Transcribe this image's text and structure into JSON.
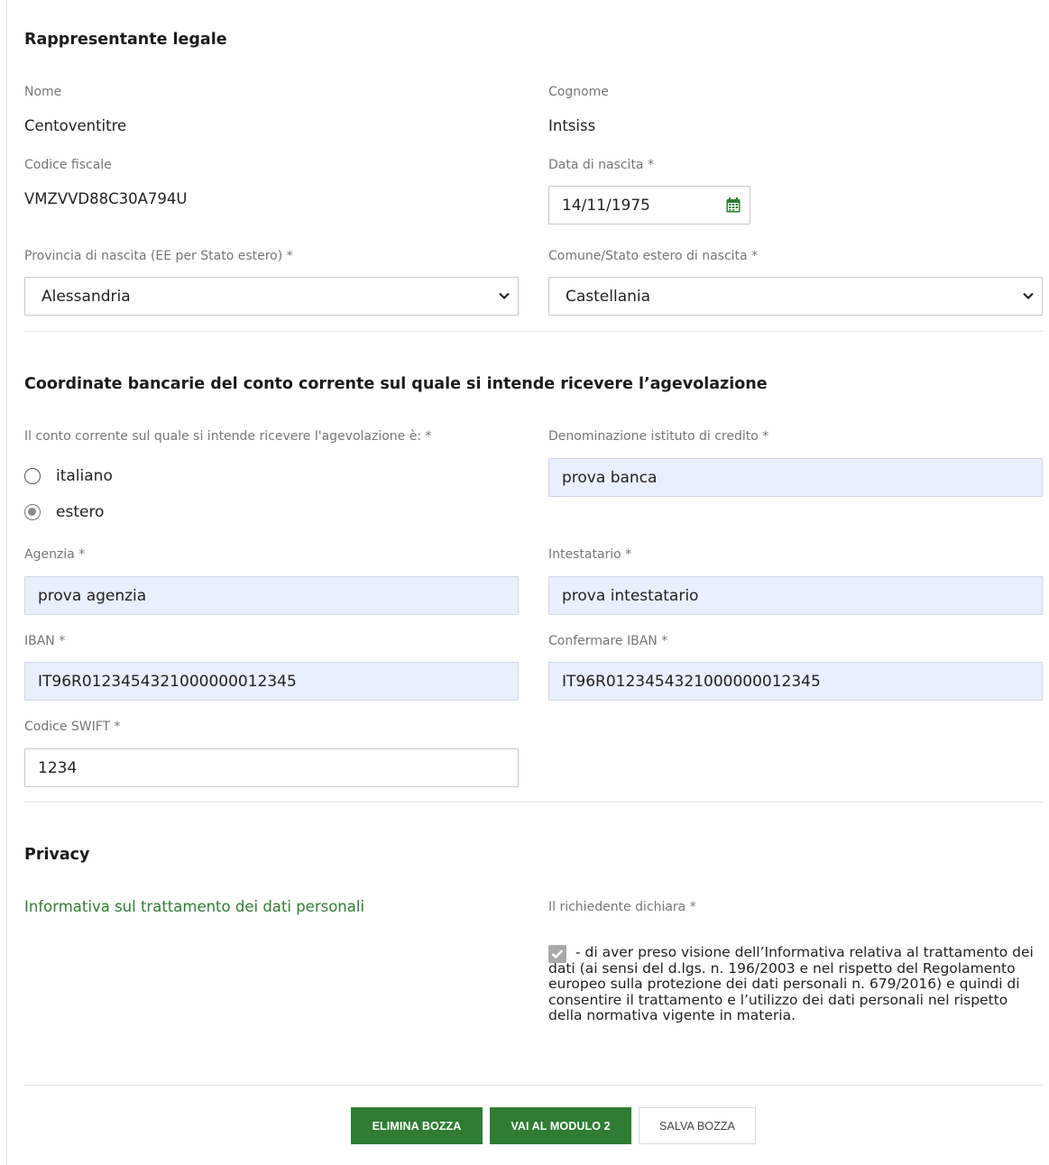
{
  "rappresentante": {
    "title": "Rappresentante legale",
    "nome_label": "Nome",
    "nome_value": "Centoventitre",
    "cognome_label": "Cognome",
    "cognome_value": "Intsiss",
    "cf_label": "Codice fiscale",
    "cf_value": "VMZVVD88C30A794U",
    "nascita_label": "Data di nascita *",
    "nascita_value": "14/11/1975",
    "provincia_label": "Provincia di nascita (EE per Stato estero) *",
    "provincia_value": "Alessandria",
    "comune_label": "Comune/Stato estero di nascita *",
    "comune_value": "Castellania"
  },
  "banca": {
    "title": "Coordinate bancarie del conto corrente sul quale si intende ricevere l’agevolazione",
    "conto_label": "Il conto corrente sul quale si intende ricevere l'agevolazione è: *",
    "option_italiano": "italiano",
    "option_estero": "estero",
    "selected_option": "estero",
    "istituto_label": "Denominazione istituto di credito *",
    "istituto_value": "prova banca",
    "agenzia_label": "Agenzia *",
    "agenzia_value": "prova agenzia",
    "intestatario_label": "Intestatario *",
    "intestatario_value": "prova intestatario",
    "iban_label": "IBAN *",
    "iban_value": "IT96R0123454321000000012345",
    "conferma_iban_label": "Confermare IBAN *",
    "conferma_iban_value": "IT96R0123454321000000012345",
    "swift_label": "Codice SWIFT *",
    "swift_value": "1234"
  },
  "privacy": {
    "title": "Privacy",
    "link_text": "Informativa sul trattamento dei dati personali",
    "dichiara_label": "Il richiedente dichiara *",
    "declaration_text": "- di aver preso visione dell’Informativa relativa al trattamento dei dati (ai sensi del d.lgs. n. 196/2003 e nel rispetto del Regolamento europeo sulla protezione dei dati personali n. 679/2016) e quindi di consentire il trattamento e l’utilizzo dei dati personali nel rispetto della normativa vigente in materia.",
    "checked": true
  },
  "actions": {
    "elimina_label": "ELIMINA BOZZA",
    "vai_label": "VAI AL MODULO 2",
    "salva_label": "SALVA BOZZA"
  },
  "colors": {
    "accent_green": "#2e7d32",
    "filled_input_bg": "#e8effd",
    "label_gray": "#767676"
  },
  "icons": {
    "date_picker": "calendar-icon",
    "select": "chevron-down-icon",
    "checkbox": "checkmark-icon"
  }
}
